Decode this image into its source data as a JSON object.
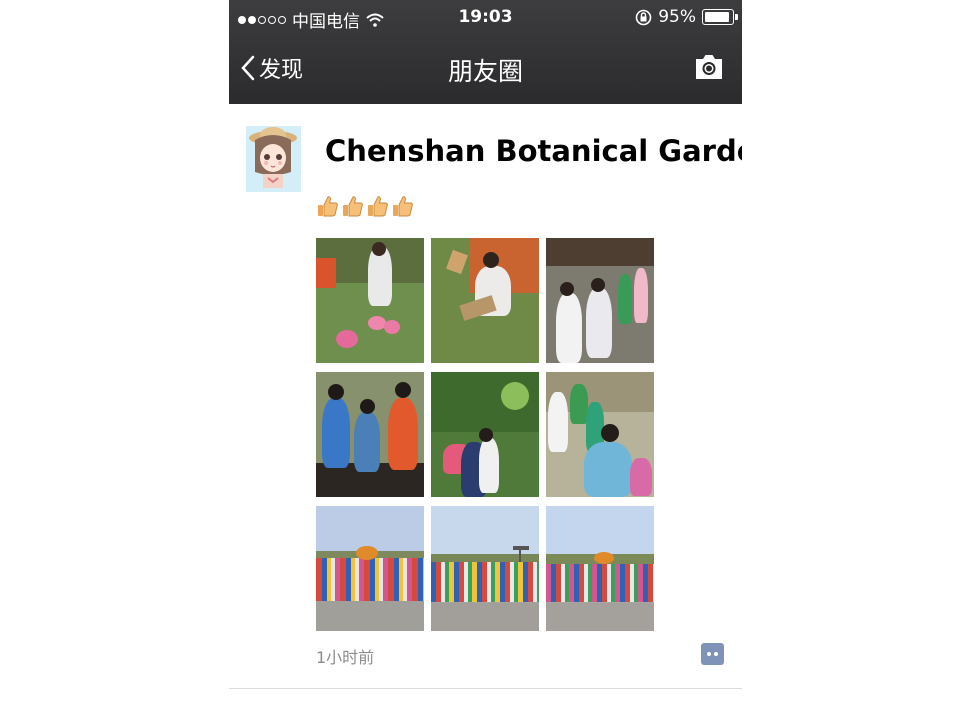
{
  "status_bar": {
    "carrier": "中国电信",
    "time": "19:03",
    "battery_text": "95%",
    "battery_level": 0.95,
    "signal_bars_filled": 2,
    "signal_bars_total": 5
  },
  "nav": {
    "back_label": "发现",
    "title": "朋友圈"
  },
  "post": {
    "author": "Chenshan Botanical Garden",
    "emoji_count": 4,
    "timestamp": "1小时前",
    "photo_count": 9
  },
  "colors": {
    "navbar_bg": "#2b2b2d",
    "comment_icon": "#7f93b8",
    "timestamp": "#8c8c8c"
  }
}
